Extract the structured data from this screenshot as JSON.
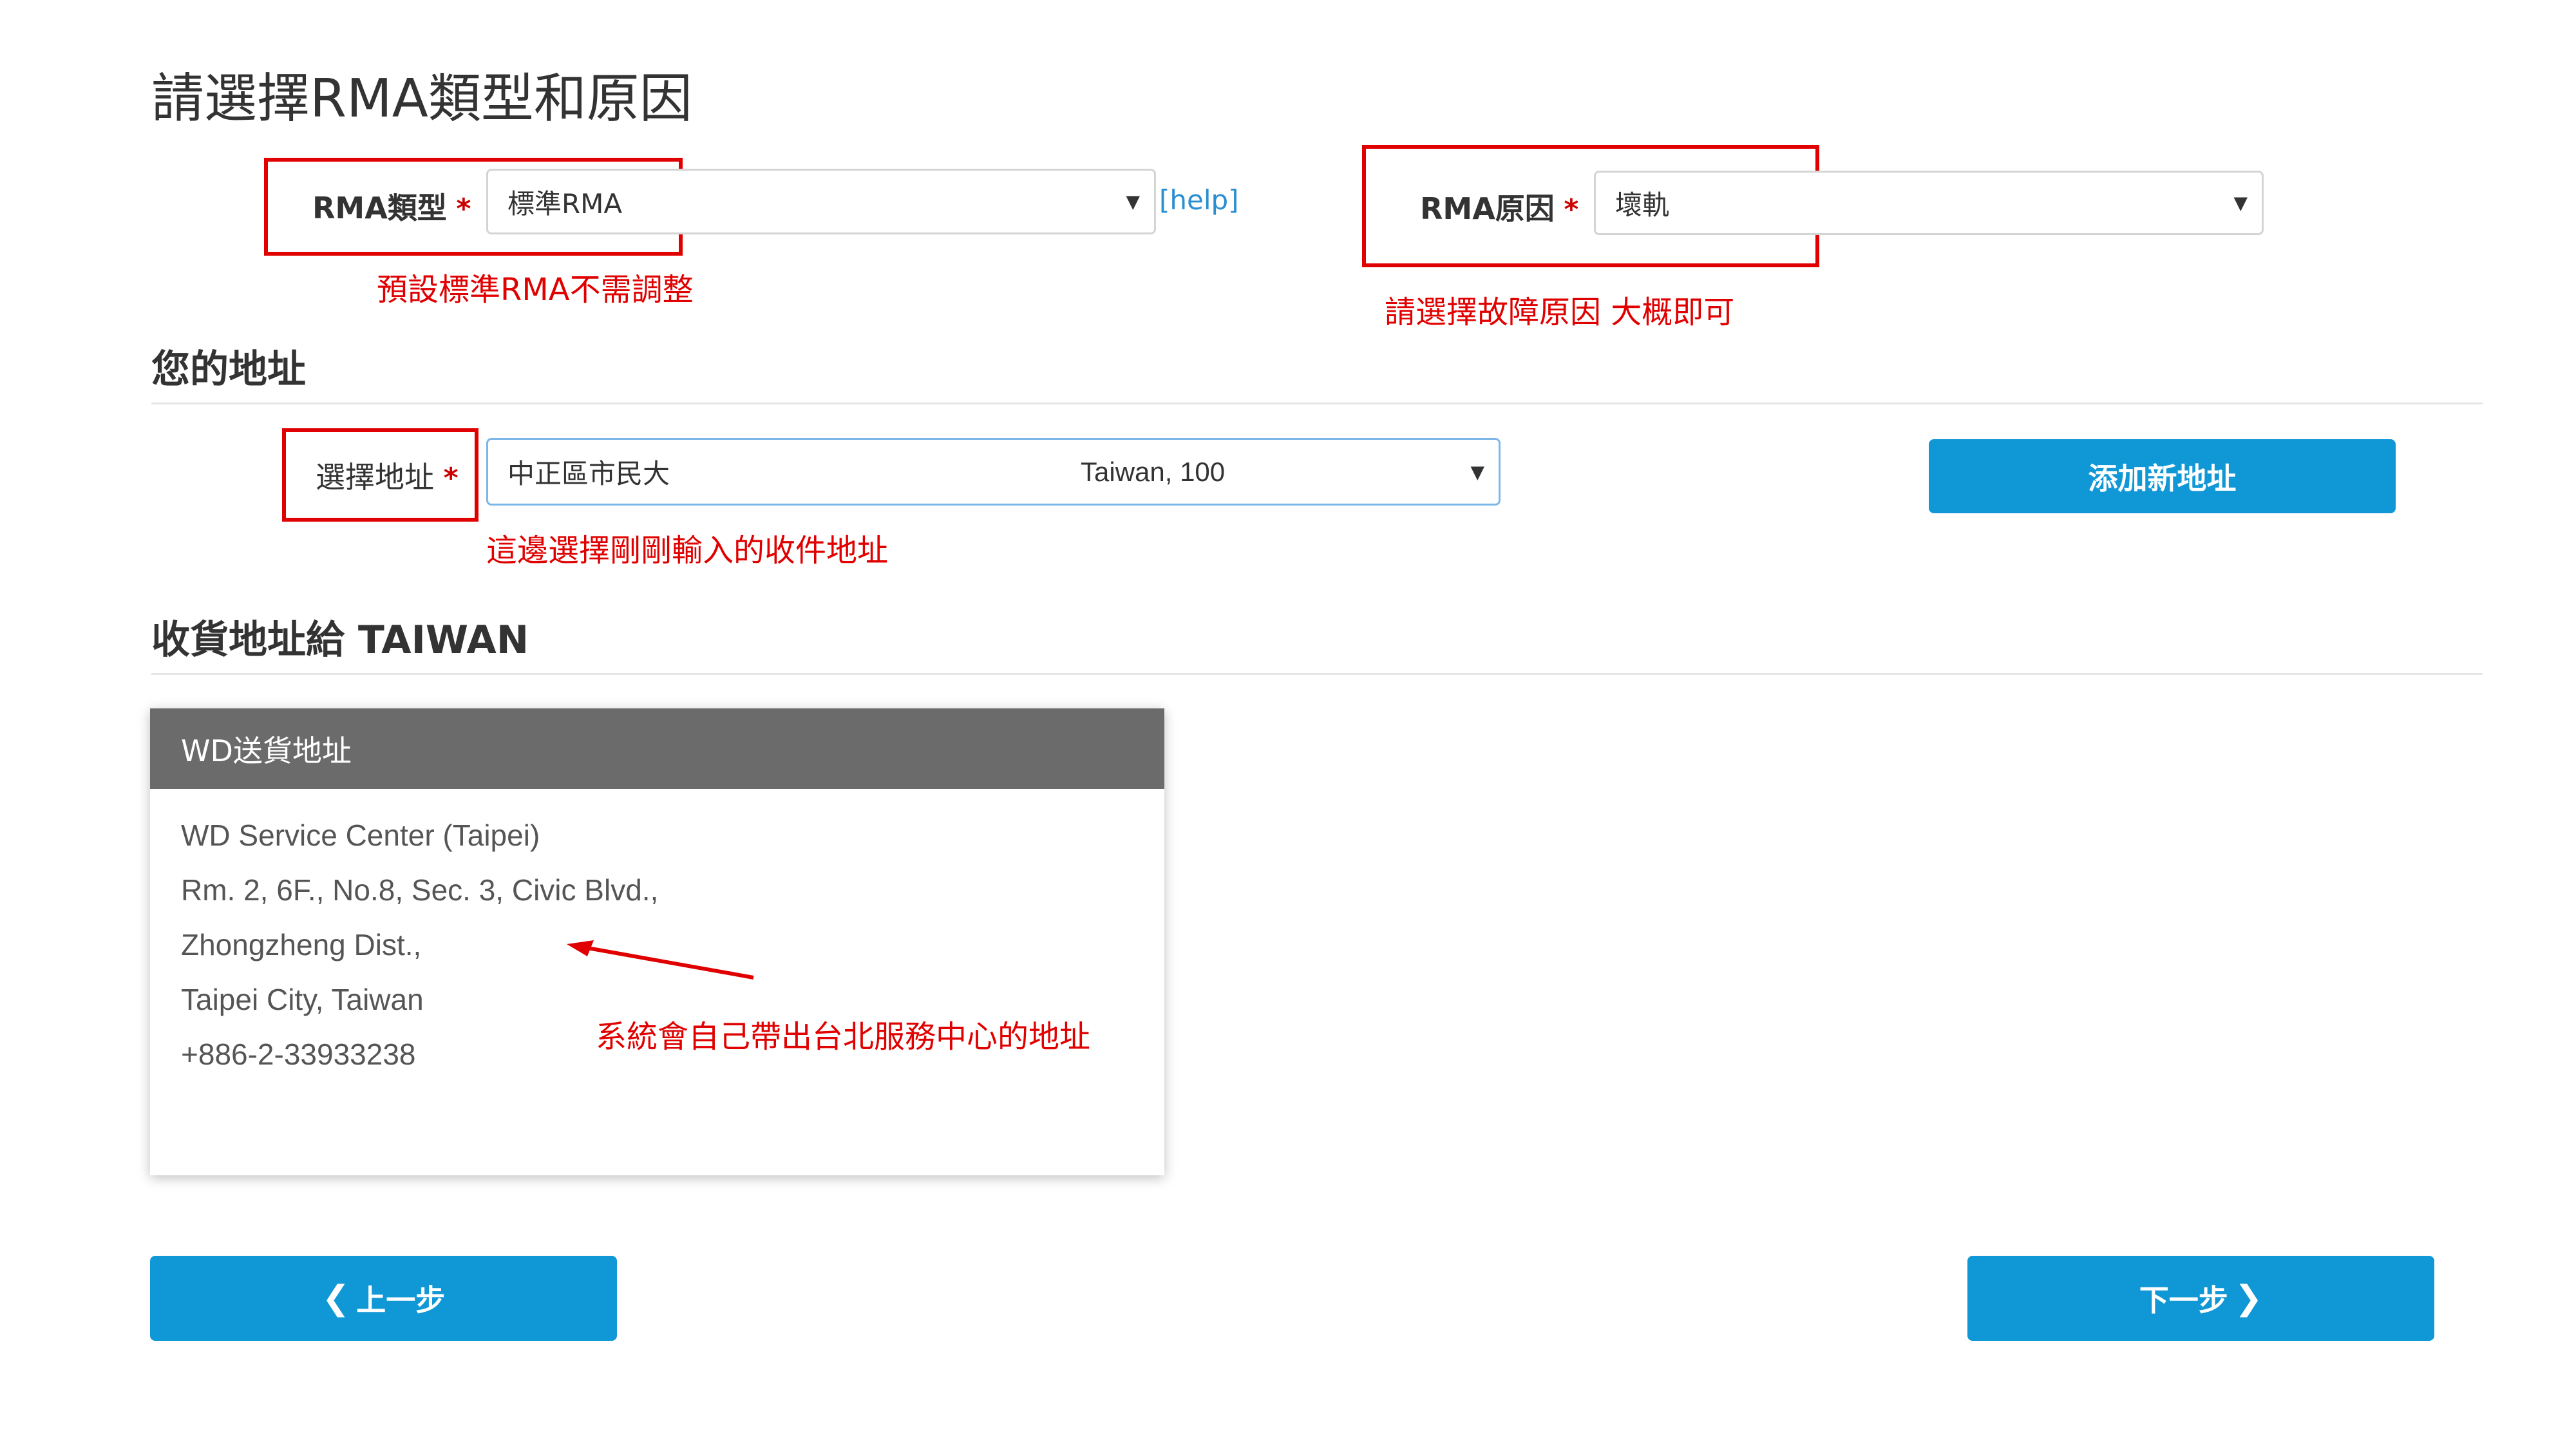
{
  "page_title": "請選擇RMA類型和原因",
  "rma_type": {
    "label": "RMA類型",
    "required_mark": "*",
    "value": "標準RMA",
    "help_link": "[help]",
    "note": "預設標準RMA不需調整"
  },
  "rma_reason": {
    "label": "RMA原因",
    "required_mark": "*",
    "value": "壞軌",
    "note": "請選擇故障原因 大概即可"
  },
  "your_address": {
    "heading": "您的地址",
    "select_label": "選擇地址",
    "required_mark": "*",
    "selected_prefix": "中正區市民大",
    "selected_suffix": "Taiwan, 100",
    "note": "這邊選擇剛剛輸入的收件地址",
    "add_button": "添加新地址"
  },
  "shipping": {
    "heading": "收貨地址給 TAIWAN",
    "card_title": "WD送貨地址",
    "address_lines": [
      "WD Service Center (Taipei)",
      "Rm. 2, 6F., No.8, Sec. 3, Civic Blvd.,",
      "Zhongzheng Dist.,",
      "Taipei City, Taiwan",
      "+886-2-33933238"
    ],
    "annotation": "系統會自己帶出台北服務中心的地址"
  },
  "nav": {
    "prev": "上一步",
    "next": "下一步"
  },
  "icons": {
    "caret": "chevron-down-icon",
    "prev": "chevron-left-icon",
    "next": "chevron-right-icon",
    "annotation_arrow": "arrow-icon"
  },
  "colors": {
    "primary_button": "#0f97d6",
    "annotation_red": "#e00000",
    "card_header": "#6b6b6b",
    "help_link": "#2a8fd1"
  }
}
